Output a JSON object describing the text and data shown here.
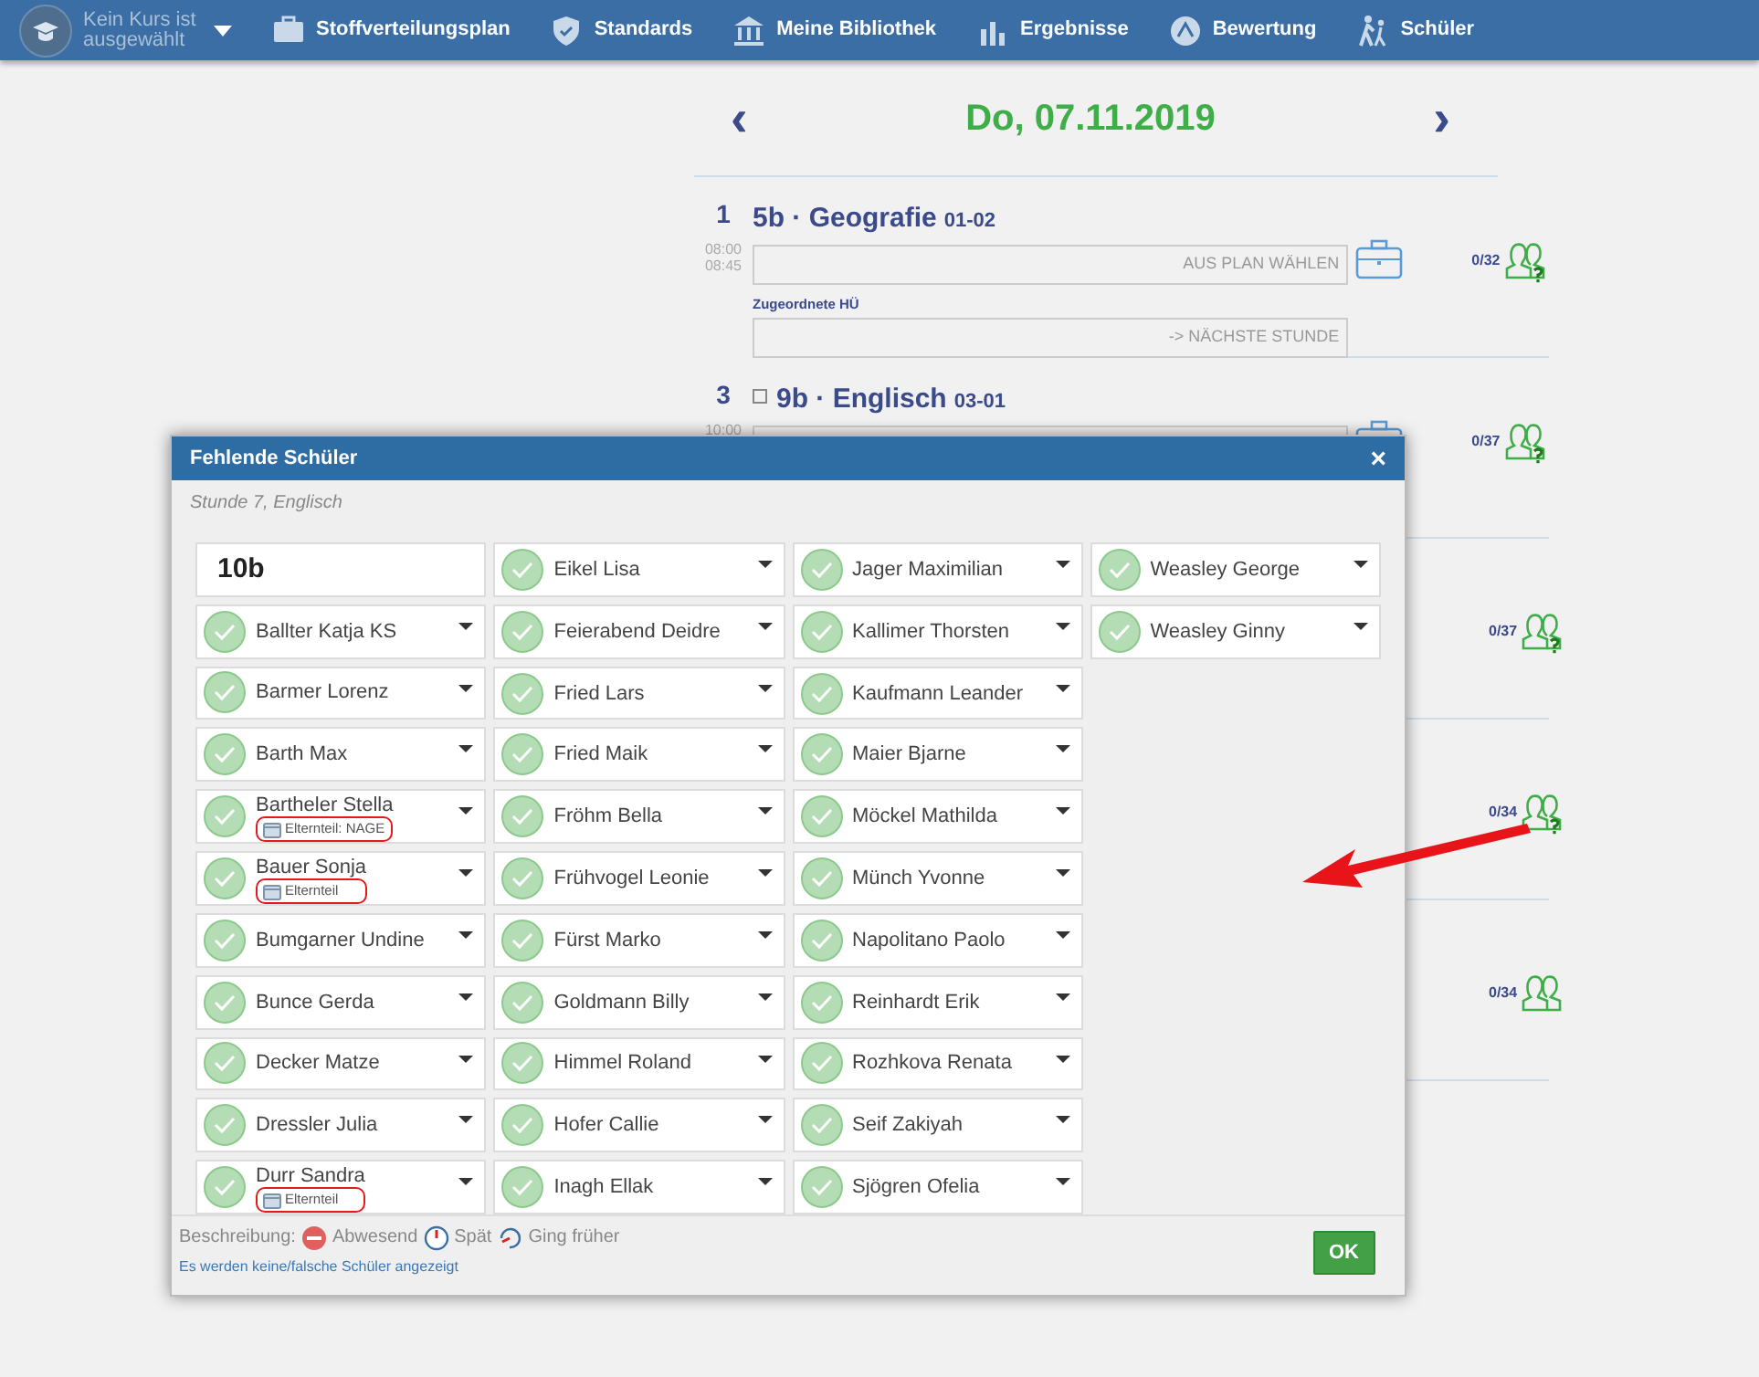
{
  "navbar": {
    "course": "Kein Kurs ist ausgewählt",
    "items": [
      {
        "kind": "plan",
        "label": "Stoffverteilungsplan"
      },
      {
        "kind": "shield",
        "label": "Standards"
      },
      {
        "kind": "library",
        "label": "Meine Bibliothek"
      },
      {
        "kind": "chart",
        "label": "Ergebnisse"
      },
      {
        "kind": "grade",
        "label": "Bewertung"
      },
      {
        "kind": "walk",
        "label": "Schüler"
      }
    ]
  },
  "date_header": {
    "prev": "‹",
    "title": "Do, 07.11.2019",
    "next": "›"
  },
  "lessons": [
    {
      "number": "1",
      "start": "08:00",
      "end": "08:45",
      "class_subject": "5b · Geografie",
      "room": "01-02",
      "plan_field": "AUS PLAN WÄHLEN",
      "hw_label": "Zugeordnete HÜ",
      "hw_field": "-> NÄCHSTE STUNDE",
      "count": "0/32",
      "unconfirmed": true
    },
    {
      "number": "3",
      "start": "10:00",
      "class_subject": "9b · Englisch",
      "room": "03-01",
      "collapsible": true,
      "count": "0/37",
      "unconfirmed": true
    },
    {
      "count": "0/37",
      "unconfirmed": true
    },
    {
      "count": "0/34",
      "unconfirmed": true
    },
    {
      "count": "0/34",
      "unconfirmed": false
    }
  ],
  "modal": {
    "title": "Fehlende Schüler",
    "close": "×",
    "subtitle": "Stunde 7, Englisch",
    "columns": [
      {
        "heading": "10b",
        "students": [
          {
            "name": "Ballter Katja KS",
            "present": true
          },
          {
            "name": "Barmer Lorenz",
            "present": true
          },
          {
            "name": "Barth Max",
            "present": true
          },
          {
            "name": "Bartheler Stella",
            "present": true,
            "note": "Elternteil: NAGE",
            "highlighted": true
          },
          {
            "name": "Bauer Sonja",
            "present": true,
            "note": "Elternteil",
            "highlighted": true
          },
          {
            "name": "Bumgarner Undine",
            "present": true
          },
          {
            "name": "Bunce Gerda",
            "present": true
          },
          {
            "name": "Decker Matze",
            "present": true
          },
          {
            "name": "Dressler Julia",
            "present": true
          },
          {
            "name": "Durr Sandra",
            "present": true,
            "note": "Elternteil",
            "highlighted": true
          }
        ]
      },
      {
        "students": [
          {
            "name": "Eikel Lisa",
            "present": true
          },
          {
            "name": "Feierabend Deidre",
            "present": true
          },
          {
            "name": "Fried Lars",
            "present": true
          },
          {
            "name": "Fried Maik",
            "present": true
          },
          {
            "name": "Fröhm Bella",
            "present": true
          },
          {
            "name": "Frühvogel Leonie",
            "present": true
          },
          {
            "name": "Fürst Marko",
            "present": true
          },
          {
            "name": "Goldmann Billy",
            "present": true
          },
          {
            "name": "Himmel Roland",
            "present": true
          },
          {
            "name": "Hofer Callie",
            "present": true
          },
          {
            "name": "Inagh Ellak",
            "present": true
          }
        ]
      },
      {
        "students": [
          {
            "name": "Jager Maximilian",
            "present": true
          },
          {
            "name": "Kallimer Thorsten",
            "present": true
          },
          {
            "name": "Kaufmann Leander",
            "present": true
          },
          {
            "name": "Maier Bjarne",
            "present": true
          },
          {
            "name": "Möckel Mathilda",
            "present": true
          },
          {
            "name": "Münch Yvonne",
            "present": true
          },
          {
            "name": "Napolitano Paolo",
            "present": true
          },
          {
            "name": "Reinhardt Erik",
            "present": true
          },
          {
            "name": "Rozhkova Renata",
            "present": true
          },
          {
            "name": "Seif Zakiyah",
            "present": true
          },
          {
            "name": "Sjögren Ofelia",
            "present": true
          }
        ]
      },
      {
        "students": [
          {
            "name": "Weasley George",
            "present": true
          },
          {
            "name": "Weasley Ginny",
            "present": true
          }
        ]
      }
    ],
    "legend": {
      "label": "Beschreibung:",
      "items": [
        {
          "kind": "absent",
          "label": "Abwesend"
        },
        {
          "kind": "late",
          "label": "Spät"
        },
        {
          "kind": "early",
          "label": "Ging früher"
        }
      ]
    },
    "help_link": "Es werden keine/falsche Schüler angezeigt",
    "ok_button": "OK"
  }
}
